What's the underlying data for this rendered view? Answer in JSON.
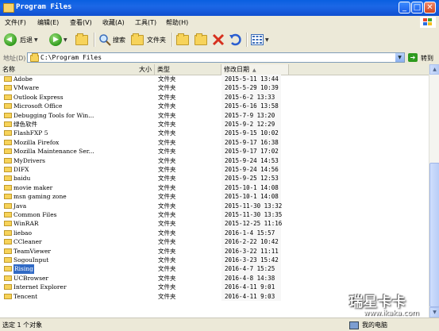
{
  "window": {
    "title": "Program Files"
  },
  "menu": [
    "文件(F)",
    "编辑(E)",
    "查看(V)",
    "收藏(A)",
    "工具(T)",
    "帮助(H)"
  ],
  "toolbar": {
    "back": "后退",
    "search": "搜索",
    "folders": "文件夹"
  },
  "address": {
    "label": "地址(D)",
    "value": "C:\\Program Files",
    "go": "转到"
  },
  "columns": {
    "name": "名称",
    "size": "大小",
    "type": "类型",
    "modified": "修改日期"
  },
  "files": [
    {
      "name": "Adobe",
      "type": "文件夹",
      "modified": "2015-5-11 13:44"
    },
    {
      "name": "VMware",
      "type": "文件夹",
      "modified": "2015-5-29 10:39"
    },
    {
      "name": "Outlook Express",
      "type": "文件夹",
      "modified": "2015-6-2 13:33"
    },
    {
      "name": "Microsoft Office",
      "type": "文件夹",
      "modified": "2015-6-16 13:58"
    },
    {
      "name": "Debugging Tools for Win...",
      "type": "文件夹",
      "modified": "2015-7-9 13:20"
    },
    {
      "name": "绿色软件",
      "type": "文件夹",
      "modified": "2015-9-2 12:29"
    },
    {
      "name": "FlashFXP 5",
      "type": "文件夹",
      "modified": "2015-9-15 10:02"
    },
    {
      "name": "Mozilla Firefox",
      "type": "文件夹",
      "modified": "2015-9-17 16:38"
    },
    {
      "name": "Mozilla Maintenance Ser...",
      "type": "文件夹",
      "modified": "2015-9-17 17:02"
    },
    {
      "name": "MyDrivers",
      "type": "文件夹",
      "modified": "2015-9-24 14:53"
    },
    {
      "name": "DIFX",
      "type": "文件夹",
      "modified": "2015-9-24 14:56"
    },
    {
      "name": "baidu",
      "type": "文件夹",
      "modified": "2015-9-25 12:53"
    },
    {
      "name": "movie maker",
      "type": "文件夹",
      "modified": "2015-10-1 14:08"
    },
    {
      "name": "msn gaming zone",
      "type": "文件夹",
      "modified": "2015-10-1 14:08"
    },
    {
      "name": "Java",
      "type": "文件夹",
      "modified": "2015-11-30 13:32"
    },
    {
      "name": "Common Files",
      "type": "文件夹",
      "modified": "2015-11-30 13:35"
    },
    {
      "name": "WinRAR",
      "type": "文件夹",
      "modified": "2015-12-25 11:16"
    },
    {
      "name": "liebao",
      "type": "文件夹",
      "modified": "2016-1-4 15:57"
    },
    {
      "name": "CCleaner",
      "type": "文件夹",
      "modified": "2016-2-22 10:42"
    },
    {
      "name": "TeamViewer",
      "type": "文件夹",
      "modified": "2016-3-22 11:11"
    },
    {
      "name": "SogouInput",
      "type": "文件夹",
      "modified": "2016-3-23 15:42"
    },
    {
      "name": "Rising",
      "type": "文件夹",
      "modified": "2016-4-7 15:25",
      "selected": true
    },
    {
      "name": "UCBrowser",
      "type": "文件夹",
      "modified": "2016-4-8 14:38"
    },
    {
      "name": "Internet Explorer",
      "type": "文件夹",
      "modified": "2016-4-11 9:01"
    },
    {
      "name": "Tencent",
      "type": "文件夹",
      "modified": "2016-4-11 9:03"
    }
  ],
  "status": {
    "left": "选定 1 个对象",
    "right": "我的电脑"
  },
  "watermark": {
    "text": "瑞星卡卡",
    "url": "www.ikaka.com"
  }
}
